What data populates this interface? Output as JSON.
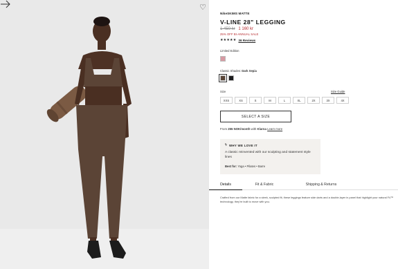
{
  "product": {
    "brand": "NikeSKIMS MATTE",
    "title": "V-LINE 28\" LEGGING",
    "price_old": "1 450 kr",
    "price_new": "1 160 kr",
    "sale_note": "25% OFF BI-ANNUAL SALE",
    "stars": "★★★★★",
    "reviews": "36 Reviews"
  },
  "variants": {
    "limited_label": "Limited Edition",
    "classic_label": "Classic Shades:",
    "classic_selected": "Dark Sepia",
    "limited_colors": [
      "#d79aa3"
    ],
    "classic_colors": [
      "#5a4638",
      "#1d1d1f"
    ]
  },
  "size": {
    "label": "Size",
    "guide": "Size Guide",
    "options": [
      "XXS",
      "XS",
      "S",
      "M",
      "L",
      "XL",
      "2X",
      "3X",
      "4X"
    ]
  },
  "cta": {
    "select_size": "SELECT A SIZE"
  },
  "klarna": {
    "prefix": "From",
    "amount": "255 NOK/month",
    "with": "with",
    "provider": "Klarna",
    "learn": "Learn more"
  },
  "love": {
    "heading": "WHY WE LOVE IT",
    "icon": "lightning-icon",
    "text": "A classic reinvented with our sculpting and statement style lines",
    "best_for_label": "Best for:",
    "best_for": "Yoga • Pilates • Barre"
  },
  "tabs": [
    "Details",
    "Fit & Fabric",
    "Shipping & Returns"
  ],
  "details_text": "Crafted from our Matte fabric for a sleek, sculpted fit, these leggings feature side darts and a double-layer in panel that highlight your natural F4™ technology, they're built to move with you.",
  "icons": {
    "wishlist": "heart-icon",
    "next": "arrow-right-icon"
  },
  "colors": {
    "sale": "#b4262a",
    "outfit": "#5b4436",
    "gallery_bg": "#e9e9e9"
  }
}
